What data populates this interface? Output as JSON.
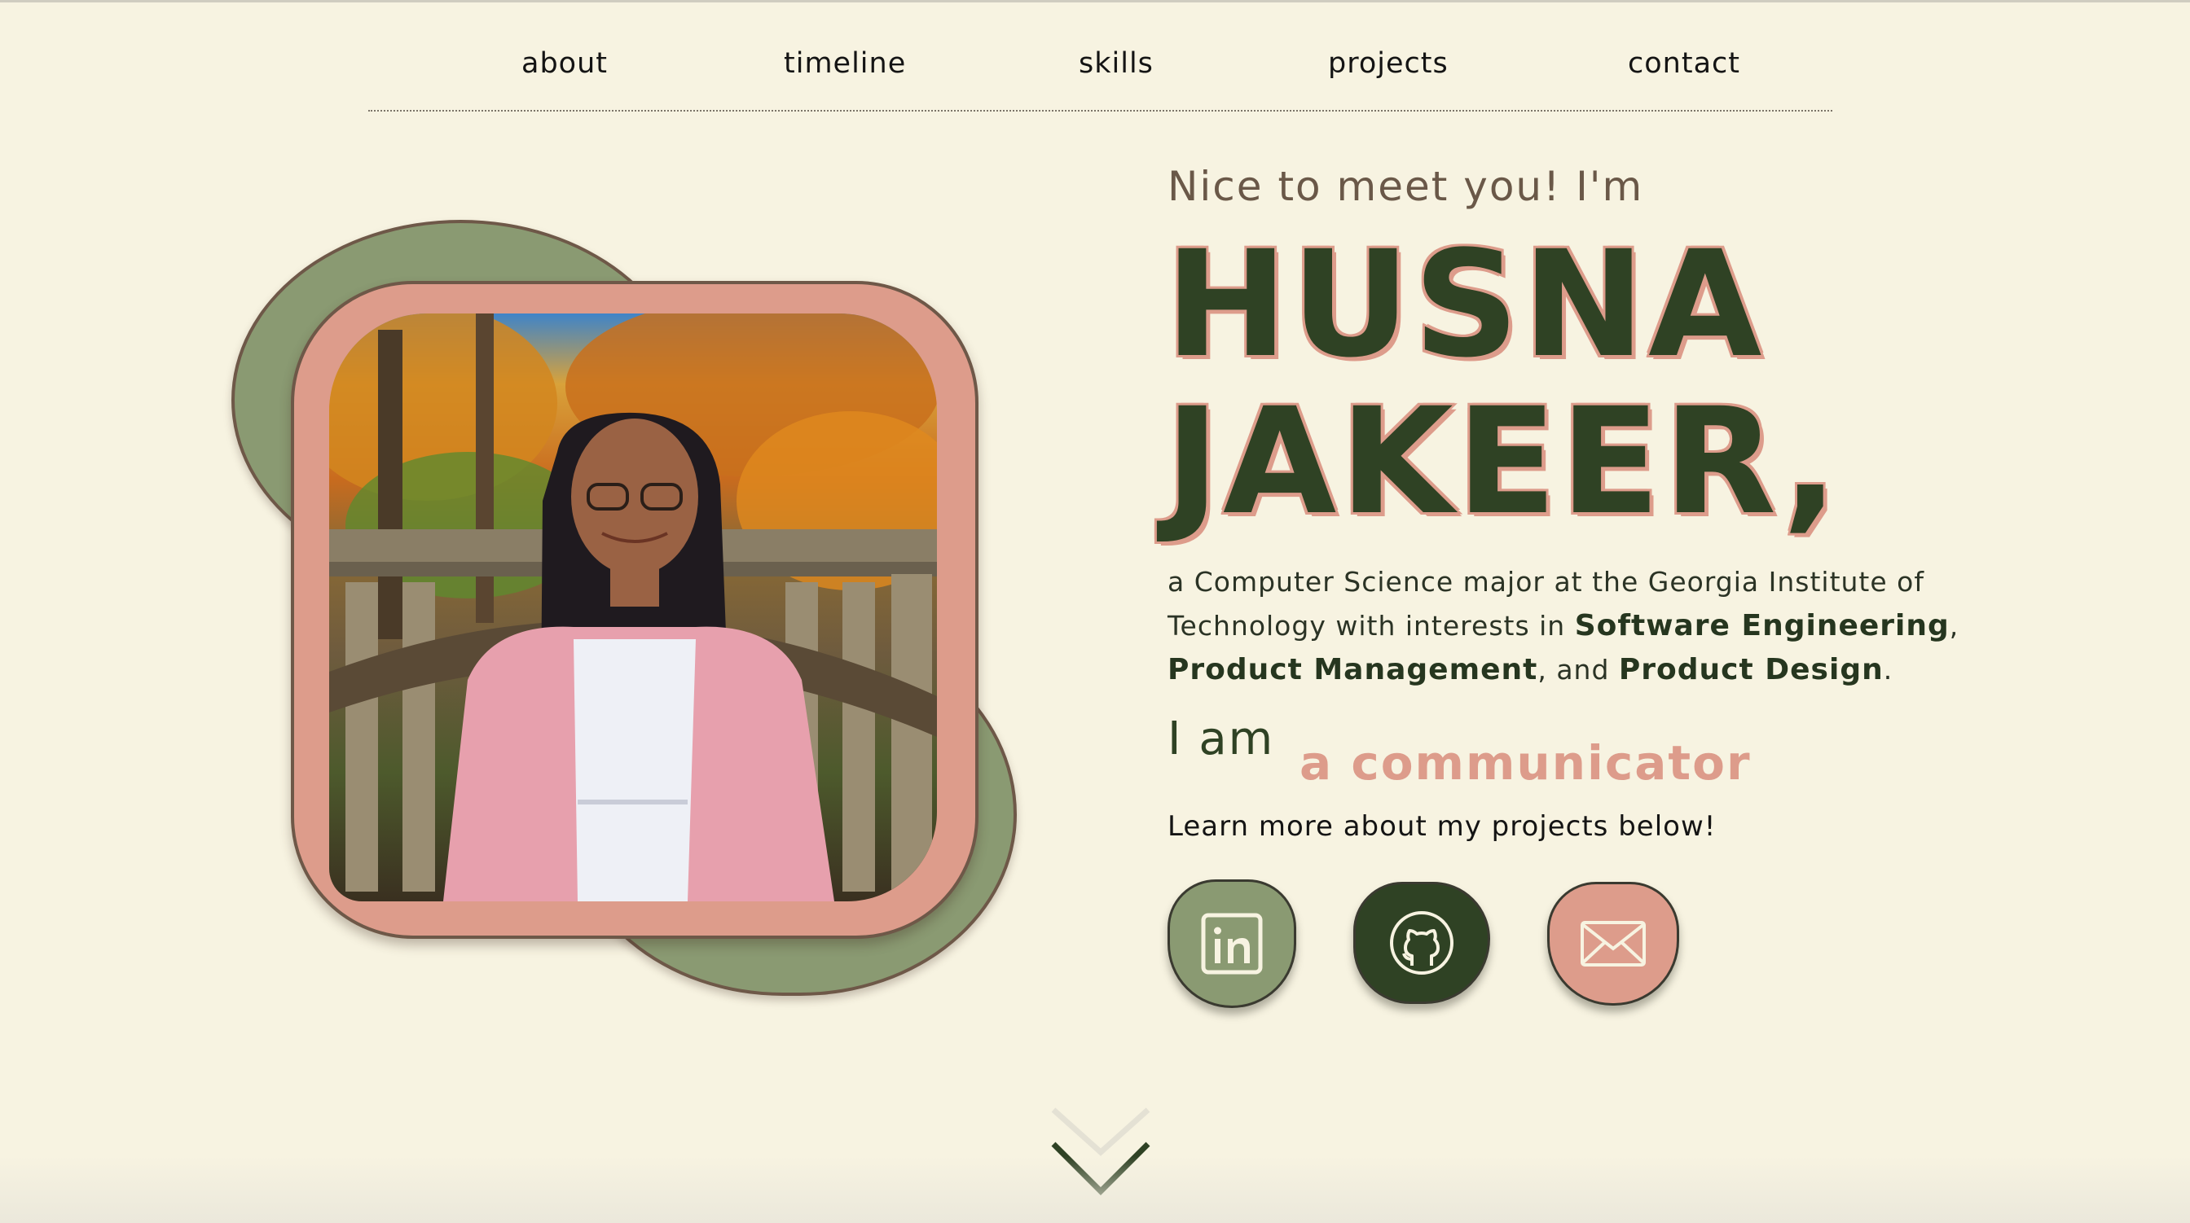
{
  "nav": {
    "items": [
      {
        "label": "about"
      },
      {
        "label": "timeline"
      },
      {
        "label": "skills"
      },
      {
        "label": "projects"
      },
      {
        "label": "contact"
      }
    ]
  },
  "hero": {
    "greeting": "Nice to meet you! I'm",
    "name_line1": "HUSNA",
    "name_line2": "JAKEER,",
    "intro": {
      "part1": "a Computer Science major at the Georgia Institute of Technology with interests in ",
      "interest1": "Software Engineering",
      "sep1": ", ",
      "interest2": "Product Management",
      "sep2": ", and ",
      "interest3": "Product Design",
      "end": "."
    },
    "iam": "I am",
    "role": "a communicator",
    "learn_more": "Learn more about my projects below!"
  },
  "social": {
    "linkedin_icon": "linkedin-icon",
    "github_icon": "github-icon",
    "email_icon": "envelope-icon"
  },
  "colors": {
    "background": "#f7f3e1",
    "sage": "#8a9a72",
    "dark_green": "#2f4224",
    "pink": "#dd9c8b"
  }
}
